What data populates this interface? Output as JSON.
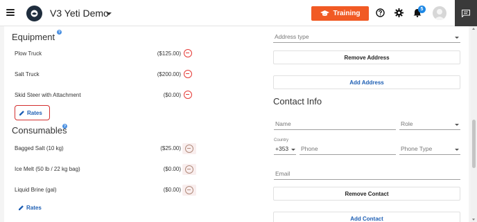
{
  "header": {
    "app_title": "V3 Yeti Demo",
    "training_label": "Training",
    "notification_count": "5"
  },
  "equipment": {
    "title": "Equipment",
    "info": "?",
    "items": [
      {
        "name": "Plow Truck",
        "price": "($125.00)"
      },
      {
        "name": "Salt Truck",
        "price": "($200.00)"
      },
      {
        "name": "Skid Steer with Attachment",
        "price": "($0.00)"
      }
    ],
    "rates_label": "Rates"
  },
  "consumables": {
    "title": "Consumables",
    "info": "?",
    "items": [
      {
        "name": "Bagged Salt (10 kg)",
        "price": "($25.00)"
      },
      {
        "name": "Ice Melt (50 lb / 22 kg bag)",
        "price": "($0.00)"
      },
      {
        "name": "Liquid Brine (gal)",
        "price": "($0.00)"
      }
    ],
    "rates_label": "Rates"
  },
  "address": {
    "type_placeholder": "Address type",
    "remove_label": "Remove Address",
    "add_label": "Add Address"
  },
  "contact": {
    "title": "Contact Info",
    "name_placeholder": "Name",
    "role_placeholder": "Role",
    "country_label": "Country",
    "country_value": "+353",
    "phone_placeholder": "Phone",
    "phone_type_placeholder": "Phone Type",
    "email_placeholder": "Email",
    "remove_label": "Remove Contact",
    "add_label": "Add Contact"
  },
  "colors": {
    "accent": "#f15a24",
    "link": "#1e5fb4",
    "remove": "#e53935",
    "highlight": "#d32f2f"
  }
}
